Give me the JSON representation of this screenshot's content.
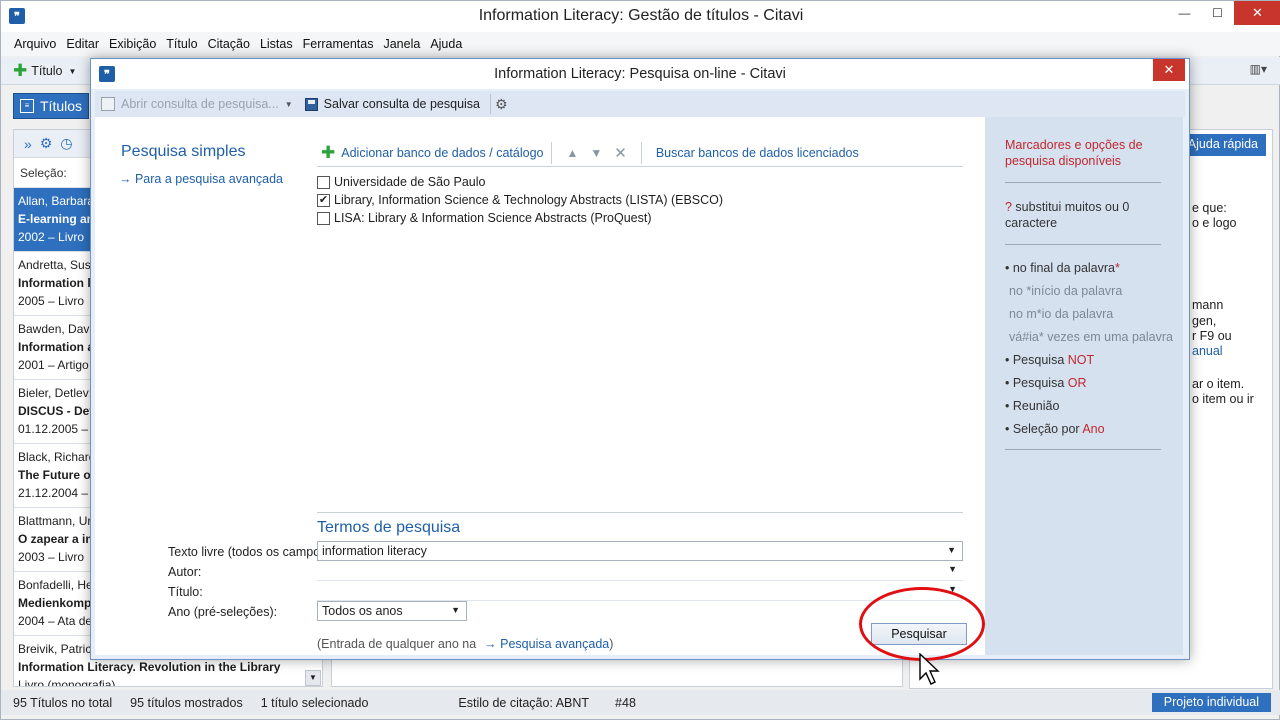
{
  "main_window": {
    "title": "Information Literacy: Gestão de títulos - Citavi",
    "logo_text": "❞",
    "controls": {
      "minimize": "—",
      "maximize": "☐",
      "close": "✕"
    }
  },
  "menu": {
    "items": [
      "Arquivo",
      "Editar",
      "Exibição",
      "Título",
      "Citação",
      "Listas",
      "Ferramentas",
      "Janela",
      "Ajuda"
    ]
  },
  "toolbar": {
    "new_title_label": "Título",
    "dropdown_arrow": "▼",
    "view_icon": "▥▾"
  },
  "nav": {
    "titles_tab": "Títulos"
  },
  "left_panel": {
    "toolbar_icons": [
      "»",
      "⚙",
      "◷"
    ],
    "selection_label": "Seleção:",
    "items": [
      {
        "line1": "Allan, Barbara",
        "line2": "E-learning an",
        "line3": "2002 – Livro",
        "selected": true
      },
      {
        "line1": "Andretta, Sus",
        "line2": "Information l",
        "line3": "2005 – Livro",
        "selected": false
      },
      {
        "line1": "Bawden, Davi",
        "line2": "Information a",
        "line3": "2001 – Artigo",
        "selected": false
      },
      {
        "line1": "Bieler, Detlev;",
        "line2": "DISCUS - Det",
        "line3": "01.12.2005 –",
        "selected": false
      },
      {
        "line1": "Black, Richard",
        "line2": "The Future o",
        "line3": "21.12.2004 –",
        "selected": false
      },
      {
        "line1": "Blattmann, Ur",
        "line2": "O zapear a in",
        "line3": "2003 – Livro",
        "selected": false
      },
      {
        "line1": "Bonfadelli, He",
        "line2": "Medienkomp",
        "line3": "2004 – Ata de",
        "selected": false
      },
      {
        "line1": "Breivik, Patric",
        "line2": "Information Literacy. Revolution in the Library",
        "line3": "Livro (monografia)",
        "selected": false
      }
    ],
    "scroll_arrow": "▼"
  },
  "right_panel": {
    "quick_help": "Ajuda rápida",
    "lines": [
      {
        "text": "e que:",
        "link": false
      },
      {
        "text": "o e logo",
        "link": false
      },
      {
        "text": "mann",
        "link": false
      },
      {
        "text": "gen,",
        "link": false
      },
      {
        "text": "r F9 ou",
        "link": false
      },
      {
        "text": "anual",
        "link": true
      },
      {
        "text": "ar o item.",
        "link": false
      },
      {
        "text": "o item ou ir",
        "link": false
      }
    ]
  },
  "statusbar": {
    "total": "95 Títulos no total",
    "shown": "95 títulos mostrados",
    "selected": "1 título selecionado",
    "citation_style": "Estilo de citação: ABNT",
    "number": "#48",
    "project_button": "Projeto individual"
  },
  "dialog": {
    "title": "Information Literacy: Pesquisa on-line - Citavi",
    "logo_text": "❞",
    "close": "✕",
    "toolbar": {
      "open_query": "Abrir consulta de pesquisa...",
      "open_arrow": "▼",
      "save_query": "Salvar consulta de pesquisa",
      "settings_icon": "⚙"
    },
    "simple_search_heading": "Pesquisa simples",
    "advanced_link": "→ Para a pesquisa avançada",
    "db_toolbar": {
      "add_database": "Adicionar banco de dados / catálogo",
      "move_up": "▲",
      "move_down": "▼",
      "remove": "✕",
      "licensed": "Buscar bancos de dados licenciados"
    },
    "databases": [
      {
        "name": "Universidade de São Paulo",
        "checked": false
      },
      {
        "name": "Library, Information Science & Technology Abstracts (LISTA) (EBSCO)",
        "checked": true
      },
      {
        "name": "LISA: Library & Information Science Abstracts (ProQuest)",
        "checked": false
      }
    ],
    "terms_heading": "Termos de pesquisa",
    "fields": {
      "free_text_label": "Texto livre (todos os campos)",
      "free_text_value": "information literacy",
      "author_label": "Autor:",
      "author_value": "",
      "title_label": "Título:",
      "title_value": "",
      "year_label": "Ano (pré-seleções):",
      "year_value": "Todos os anos"
    },
    "dropdown_arrow": "▼",
    "year_note_prefix": "(Entrada de qualquer ano na",
    "year_note_link": "→ Pesquisa avançada",
    "year_note_suffix": ")",
    "search_button": "Pesquisar",
    "help": {
      "heading": "Marcadores e opções de pesquisa disponíveis",
      "qmark": "?",
      "qmark_desc": " substitui muitos ou 0 caractere",
      "end_of_word_prefix": "• no final da palavra",
      "end_of_word_star": "*",
      "start_of_word": "no *início da palavra",
      "middle_of_word": "no m*io da palavra",
      "multiple": "vá#ia* vezes em uma palavra",
      "not_prefix": "• Pesquisa ",
      "not_kw": "NOT",
      "or_prefix": "• Pesquisa ",
      "or_kw": "OR",
      "union": "• Reunião",
      "year_prefix": "• Seleção por ",
      "year_kw": "Ano"
    }
  }
}
